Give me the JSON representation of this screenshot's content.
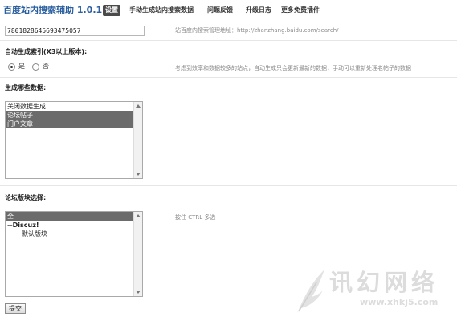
{
  "header": {
    "title": "百度站内搜索辅助 1.0.1",
    "tabs": [
      {
        "label": "设置",
        "active": true
      },
      {
        "label": "手动生成站内搜索数据",
        "active": false
      },
      {
        "label": "问题反馈",
        "active": false
      },
      {
        "label": "升级日志",
        "active": false
      },
      {
        "label": "更多免费插件",
        "active": false
      }
    ]
  },
  "site_id": {
    "value": "7801828645693475057",
    "hint": "站百度内搜索管理地址：http://zhanzhang.baidu.com/search/"
  },
  "auto_index": {
    "label": "自动生成索引(X3以上版本):",
    "options": [
      {
        "label": "是",
        "checked": true
      },
      {
        "label": "否",
        "checked": false
      }
    ],
    "hint": "考虑到效率和数据较多的站点，自动生成只会更新最新的数据，手动可以重新处理老帖子的数据"
  },
  "data_types": {
    "label": "生成哪些数据:",
    "options": [
      {
        "label": "关闭数据生成",
        "selected": false
      },
      {
        "label": "论坛帖子",
        "selected": true
      },
      {
        "label": "门户文章",
        "selected": true
      }
    ]
  },
  "forum_select": {
    "label": "论坛版块选择:",
    "hint": "按住 CTRL 多选",
    "options": [
      {
        "label": "全",
        "selected": true,
        "style": "normal"
      },
      {
        "label": "--Discuz!",
        "selected": false,
        "style": "group"
      },
      {
        "label": "默认版块",
        "selected": false,
        "style": "child"
      }
    ]
  },
  "submit": {
    "label": "提交"
  },
  "watermark": {
    "text": "讯幻网络",
    "url": "www.xhkj5.com"
  },
  "colors": {
    "title": "#2b5f9f",
    "active_tab": "#4a4a4a",
    "selected_option": "#6b6b6b"
  }
}
